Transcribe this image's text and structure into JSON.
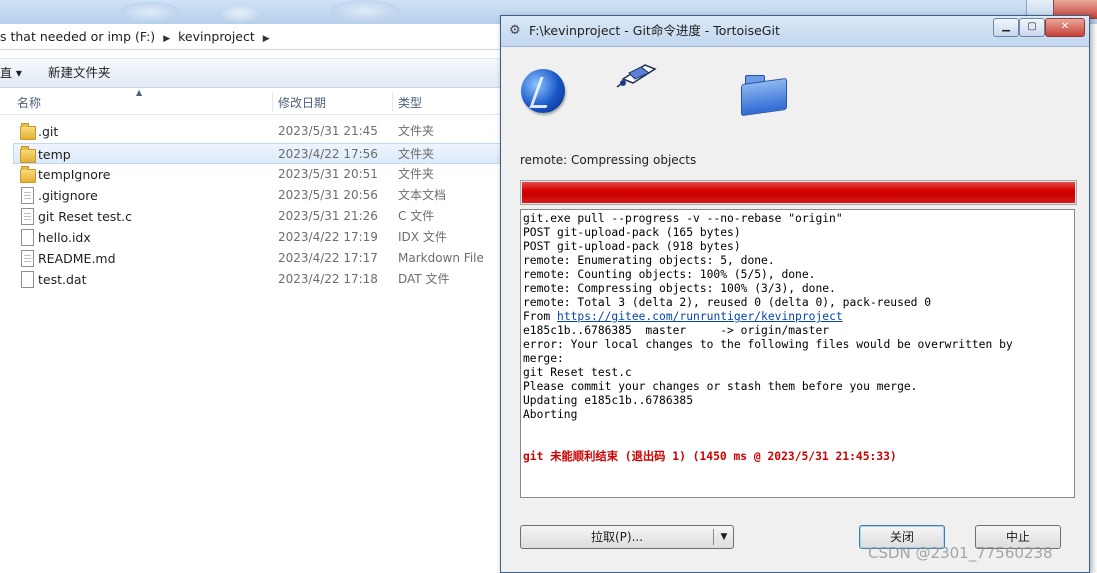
{
  "explorer": {
    "address": {
      "drive_crumb": "s that needed or imp (F:)",
      "folder_crumb": "kevinproject"
    },
    "toolbar": {
      "organize_label": "直 ▾",
      "new_folder_label": "新建文件夹"
    },
    "columns": {
      "name": "名称",
      "date": "修改日期",
      "type": "类型"
    },
    "files": [
      {
        "name": ".git",
        "date": "2023/5/31 21:45",
        "type": "文件夹",
        "icon": "folder-icon"
      },
      {
        "name": "temp",
        "date": "2023/4/22 17:56",
        "type": "文件夹",
        "icon": "folder-icon"
      },
      {
        "name": "tempIgnore",
        "date": "2023/5/31 20:51",
        "type": "文件夹",
        "icon": "folder-icon"
      },
      {
        "name": ".gitignore",
        "date": "2023/5/31 20:56",
        "type": "文本文档",
        "icon": "text-file-icon"
      },
      {
        "name": "git Reset test.c",
        "date": "2023/5/31 21:26",
        "type": "C 文件",
        "icon": "c-file-icon"
      },
      {
        "name": "hello.idx",
        "date": "2023/4/22 17:19",
        "type": "IDX 文件",
        "icon": "file-icon"
      },
      {
        "name": "README.md",
        "date": "2023/4/22 17:17",
        "type": "Markdown File",
        "icon": "markdown-file-icon"
      },
      {
        "name": "test.dat",
        "date": "2023/4/22 17:18",
        "type": "DAT 文件",
        "icon": "file-icon"
      }
    ]
  },
  "dialog": {
    "title": "F:\\kevinproject - Git命令进度 - TortoiseGit",
    "caption_buttons": {
      "minimize": "▁",
      "maximize": "▢",
      "close": "✕"
    },
    "status": "remote: Compressing objects",
    "progress_percent": 100,
    "progress_color": "#d60000",
    "log": {
      "lines_before_link": [
        "git.exe pull --progress -v --no-rebase \"origin\"",
        "POST git-upload-pack (165 bytes)",
        "POST git-upload-pack (918 bytes)",
        "remote: Enumerating objects: 5, done.",
        "remote: Counting objects: 100% (5/5), done.",
        "remote: Compressing objects: 100% (3/3), done.",
        "remote: Total 3 (delta 2), reused 0 (delta 0), pack-reused 0"
      ],
      "from_prefix": "From ",
      "from_url": "https://gitee.com/runruntiger/kevinproject",
      "lines_after_link": [
        "e185c1b..6786385  master     -> origin/master",
        "error: Your local changes to the following files would be overwritten by",
        "merge:",
        "git Reset test.c",
        "Please commit your changes or stash them before you merge.",
        "Updating e185c1b..6786385",
        "Aborting"
      ],
      "error_summary": "git 未能顺利结束 (退出码 1) (1450 ms @ 2023/5/31 21:45:33)",
      "error_color": "#cc0000"
    },
    "buttons": {
      "pull": "拉取(P)...",
      "close": "关闭",
      "abort": "中止"
    }
  },
  "watermark": "CSDN @2301_77560238"
}
